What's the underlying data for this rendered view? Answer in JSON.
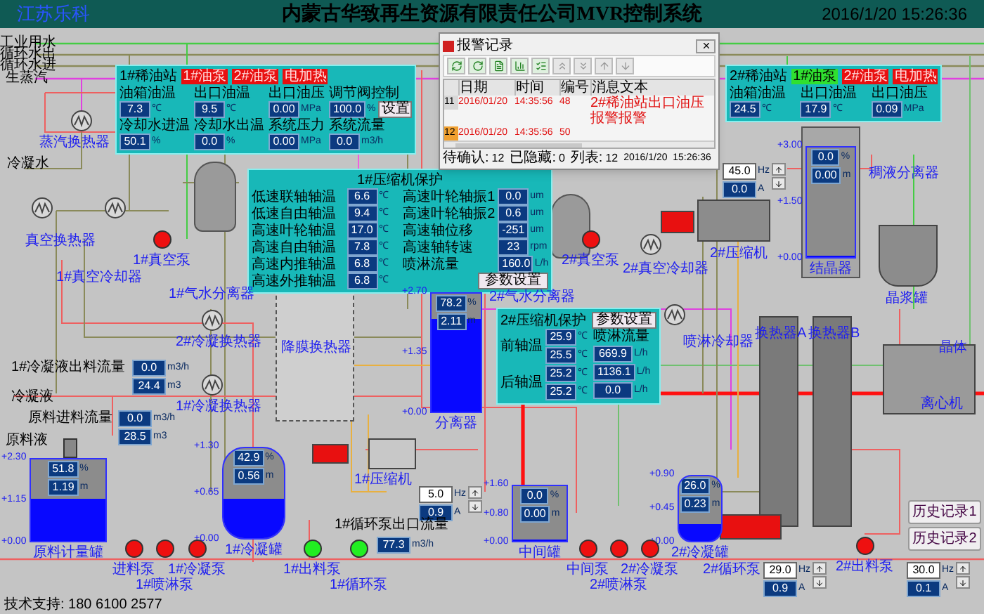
{
  "header": {
    "logo": "江苏乐科",
    "title": "内蒙古华致再生资源有限责任公司MVR控制系统",
    "datetime": "2016/1/20 15:26:36"
  },
  "line_labels": [
    "工业用水",
    "循环水出",
    "循环水进",
    "生蒸汽",
    "冷凝水",
    "冷凝液",
    "原料液"
  ],
  "oil_stations": [
    {
      "title": "1#稀油站",
      "pumps": [
        {
          "label": "1#油泵",
          "on": false
        },
        {
          "label": "2#油泵",
          "on": false
        },
        {
          "label": "电加热",
          "on": false
        }
      ],
      "readings": [
        {
          "label": "油箱油温",
          "value": "7.3",
          "unit": "℃"
        },
        {
          "label": "出口油温",
          "value": "9.5",
          "unit": "℃"
        },
        {
          "label": "出口油压",
          "value": "0.00",
          "unit": "MPa"
        },
        {
          "label": "调节阀控制",
          "value": "100.0",
          "unit": "%",
          "button": "设置"
        },
        {
          "label": "冷却水进温",
          "value": "50.1",
          "unit": "%"
        },
        {
          "label": "冷却水出温",
          "value": "0.0",
          "unit": "%"
        },
        {
          "label": "系统压力",
          "value": "0.00",
          "unit": "MPa"
        },
        {
          "label": "系统流量",
          "value": "0.0",
          "unit": "m3/h"
        }
      ]
    },
    {
      "title": "2#稀油站",
      "pumps": [
        {
          "label": "1#油泵",
          "on": true
        },
        {
          "label": "2#油泵",
          "on": false
        },
        {
          "label": "电加热",
          "on": false
        }
      ],
      "readings": [
        {
          "label": "油箱油温",
          "value": "24.5",
          "unit": "℃"
        },
        {
          "label": "出口油温",
          "value": "17.9",
          "unit": "℃"
        },
        {
          "label": "出口油压",
          "value": "0.09",
          "unit": "MPa"
        }
      ]
    }
  ],
  "compressor_1": {
    "title": "1#压缩机保护",
    "button": "参数设置",
    "readings": [
      {
        "label": "低速联轴轴温",
        "value": "6.6",
        "unit": "℃"
      },
      {
        "label": "高速叶轮轴振1",
        "value": "0.0",
        "unit": "um"
      },
      {
        "label": "低速自由轴温",
        "value": "9.4",
        "unit": "℃"
      },
      {
        "label": "高速叶轮轴振2",
        "value": "0.6",
        "unit": "um"
      },
      {
        "label": "高速叶轮轴温",
        "value": "17.0",
        "unit": "℃"
      },
      {
        "label": "高速轴位移",
        "value": "-251",
        "unit": "um"
      },
      {
        "label": "高速自由轴温",
        "value": "7.8",
        "unit": "℃"
      },
      {
        "label": "高速轴转速",
        "value": "23",
        "unit": "rpm"
      },
      {
        "label": "高速内推轴温",
        "value": "6.8",
        "unit": "℃"
      },
      {
        "label": "喷淋流量",
        "value": "160.0",
        "unit": "L/h"
      },
      {
        "label": "高速外推轴温",
        "value": "6.8",
        "unit": "℃"
      }
    ]
  },
  "compressor_2": {
    "title": "2#压缩机保护",
    "button": "参数设置",
    "bearing_groups": [
      {
        "label": "前轴温",
        "values": [
          {
            "value": "25.9",
            "unit": "℃"
          },
          {
            "value": "25.5",
            "unit": "℃"
          }
        ]
      },
      {
        "label": "后轴温",
        "values": [
          {
            "value": "25.2",
            "unit": "℃"
          },
          {
            "value": "25.2",
            "unit": "℃"
          }
        ]
      }
    ],
    "spray": {
      "label": "喷淋流量",
      "values": [
        {
          "value": "669.9",
          "unit": "L/h"
        },
        {
          "value": "1136.1",
          "unit": "L/h"
        },
        {
          "value": "0.0",
          "unit": "L/h"
        }
      ]
    }
  },
  "alarm_window": {
    "title": "报警记录",
    "columns": [
      "日期",
      "时间",
      "编号",
      "消息文本"
    ],
    "rows": [
      {
        "index": "11",
        "date": "2016/01/20",
        "time": "14:35:56",
        "number": "48",
        "message": "2#稀油站出口油压报警报警",
        "selected": false
      },
      {
        "index": "12",
        "date": "2016/01/20",
        "time": "14:35:56",
        "number": "50",
        "selected": true
      }
    ],
    "status": [
      {
        "label": "待确认:",
        "value": "12"
      },
      {
        "label": "已隐藏:",
        "value": "0"
      },
      {
        "label": "列表:",
        "value": "12"
      }
    ],
    "status_time": "2016/1/20  15:26:36"
  },
  "tanks": [
    {
      "name": "原料计量罐",
      "level": 0.52,
      "readings": [
        {
          "value": "51.8",
          "unit": "%"
        },
        {
          "value": "1.19",
          "unit": "m"
        }
      ],
      "scale": [
        "+2.30",
        "+1.15",
        "+0.00"
      ]
    },
    {
      "name": "1#冷凝罐",
      "level": 0.43,
      "readings": [
        {
          "value": "42.9",
          "unit": "%"
        },
        {
          "value": "0.56",
          "unit": "m"
        }
      ],
      "scale": [
        "+1.30",
        "+0.65",
        "+0.00"
      ]
    },
    {
      "name": "分离器",
      "level": 0.78,
      "readings": [
        {
          "value": "78.2",
          "unit": "%"
        },
        {
          "value": "2.11",
          "unit": "m"
        }
      ],
      "scale": [
        "+2.70",
        "+1.35",
        "+0.00"
      ]
    },
    {
      "name": "中间罐",
      "level": 0,
      "readings": [
        {
          "value": "0.0",
          "unit": "%"
        },
        {
          "value": "0.00",
          "unit": "m"
        }
      ],
      "scale": [
        "+1.60",
        "+0.80",
        "+0.00"
      ]
    },
    {
      "name": "2#冷凝罐",
      "level": 0.26,
      "readings": [
        {
          "value": "26.0",
          "unit": "%"
        },
        {
          "value": "0.23",
          "unit": "m"
        }
      ],
      "scale": [
        "+0.90",
        "+0.45",
        "+0.00"
      ]
    },
    {
      "name": "结晶器",
      "level": 0,
      "readings": [
        {
          "value": "0.0",
          "unit": "%"
        },
        {
          "value": "0.00",
          "unit": "m"
        }
      ],
      "scale": [
        "+3.00",
        "+1.50",
        "+0.00"
      ]
    }
  ],
  "pumps": [
    {
      "name": "1#真空泵",
      "running": false
    },
    {
      "name": "2#真空泵",
      "running": false
    },
    {
      "name": "进料泵",
      "running": false
    },
    {
      "name": "1#喷淋泵",
      "running": false
    },
    {
      "name": "1#冷凝泵",
      "running": false
    },
    {
      "name": "1#出料泵",
      "running": true
    },
    {
      "name": "1#循环泵",
      "running": true
    },
    {
      "name": "中间泵",
      "running": false
    },
    {
      "name": "2#喷淋泵",
      "running": false
    },
    {
      "name": "2#冷凝泵",
      "running": false
    },
    {
      "name": "2#出料泵",
      "running": false
    }
  ],
  "equipment": [
    "蒸汽换热器",
    "真空换热器",
    "1#真空冷却器",
    "1#气水分离器",
    "降膜换热器",
    "2#气水分离器",
    "2#真空冷却器",
    "2#压缩机",
    "稠液分离器",
    "晶浆罐",
    "喷淋冷却器",
    "换热器A",
    "换热器B",
    "晶体",
    "离心机",
    "2#冷凝换热器",
    "1#冷凝换热器",
    "1#压缩机",
    "2#循环泵"
  ],
  "flow_meters": [
    {
      "label": "1#冷凝液出料流量",
      "rate": "0.0",
      "rate_unit": "m3/h",
      "total": "24.4",
      "total_unit": "m3"
    },
    {
      "label": "原料进料流量",
      "rate": "0.0",
      "rate_unit": "m3/h",
      "total": "28.5",
      "total_unit": "m3"
    },
    {
      "label": "1#循环泵出口流量",
      "rate": "77.3",
      "rate_unit": "m3/h"
    }
  ],
  "drives": [
    {
      "hz": "45.0",
      "hz_unit": "Hz",
      "amps": "0.0",
      "amp_unit": "A"
    },
    {
      "hz": "5.0",
      "hz_unit": "Hz",
      "amps": "0.9",
      "amp_unit": "A"
    },
    {
      "hz": "29.0",
      "hz_unit": "Hz",
      "amps": "0.9",
      "amp_unit": "A"
    },
    {
      "hz": "30.0",
      "hz_unit": "Hz",
      "amps": "0.1",
      "amp_unit": "A"
    }
  ],
  "history_buttons": [
    "历史记录1",
    "历史记录2"
  ],
  "footer": "技术支持: 180 6100 2577"
}
